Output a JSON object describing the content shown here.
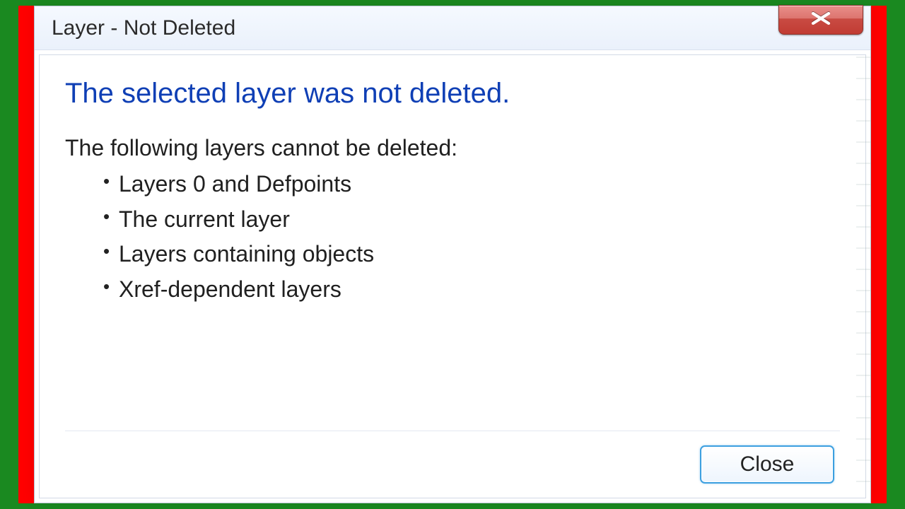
{
  "dialog": {
    "title": "Layer - Not Deleted",
    "heading": "The selected layer was not deleted.",
    "subtext": "The following layers cannot be deleted:",
    "bullets": [
      "Layers 0 and Defpoints",
      "The current layer",
      "Layers containing objects",
      "Xref-dependent layers"
    ],
    "close_button": "Close"
  },
  "colors": {
    "background": "#1a8920",
    "accent_bar": "#ff0000",
    "heading_blue": "#0f3fb5",
    "button_border": "#3c9fe0",
    "close_x_red": "#c94b43"
  }
}
